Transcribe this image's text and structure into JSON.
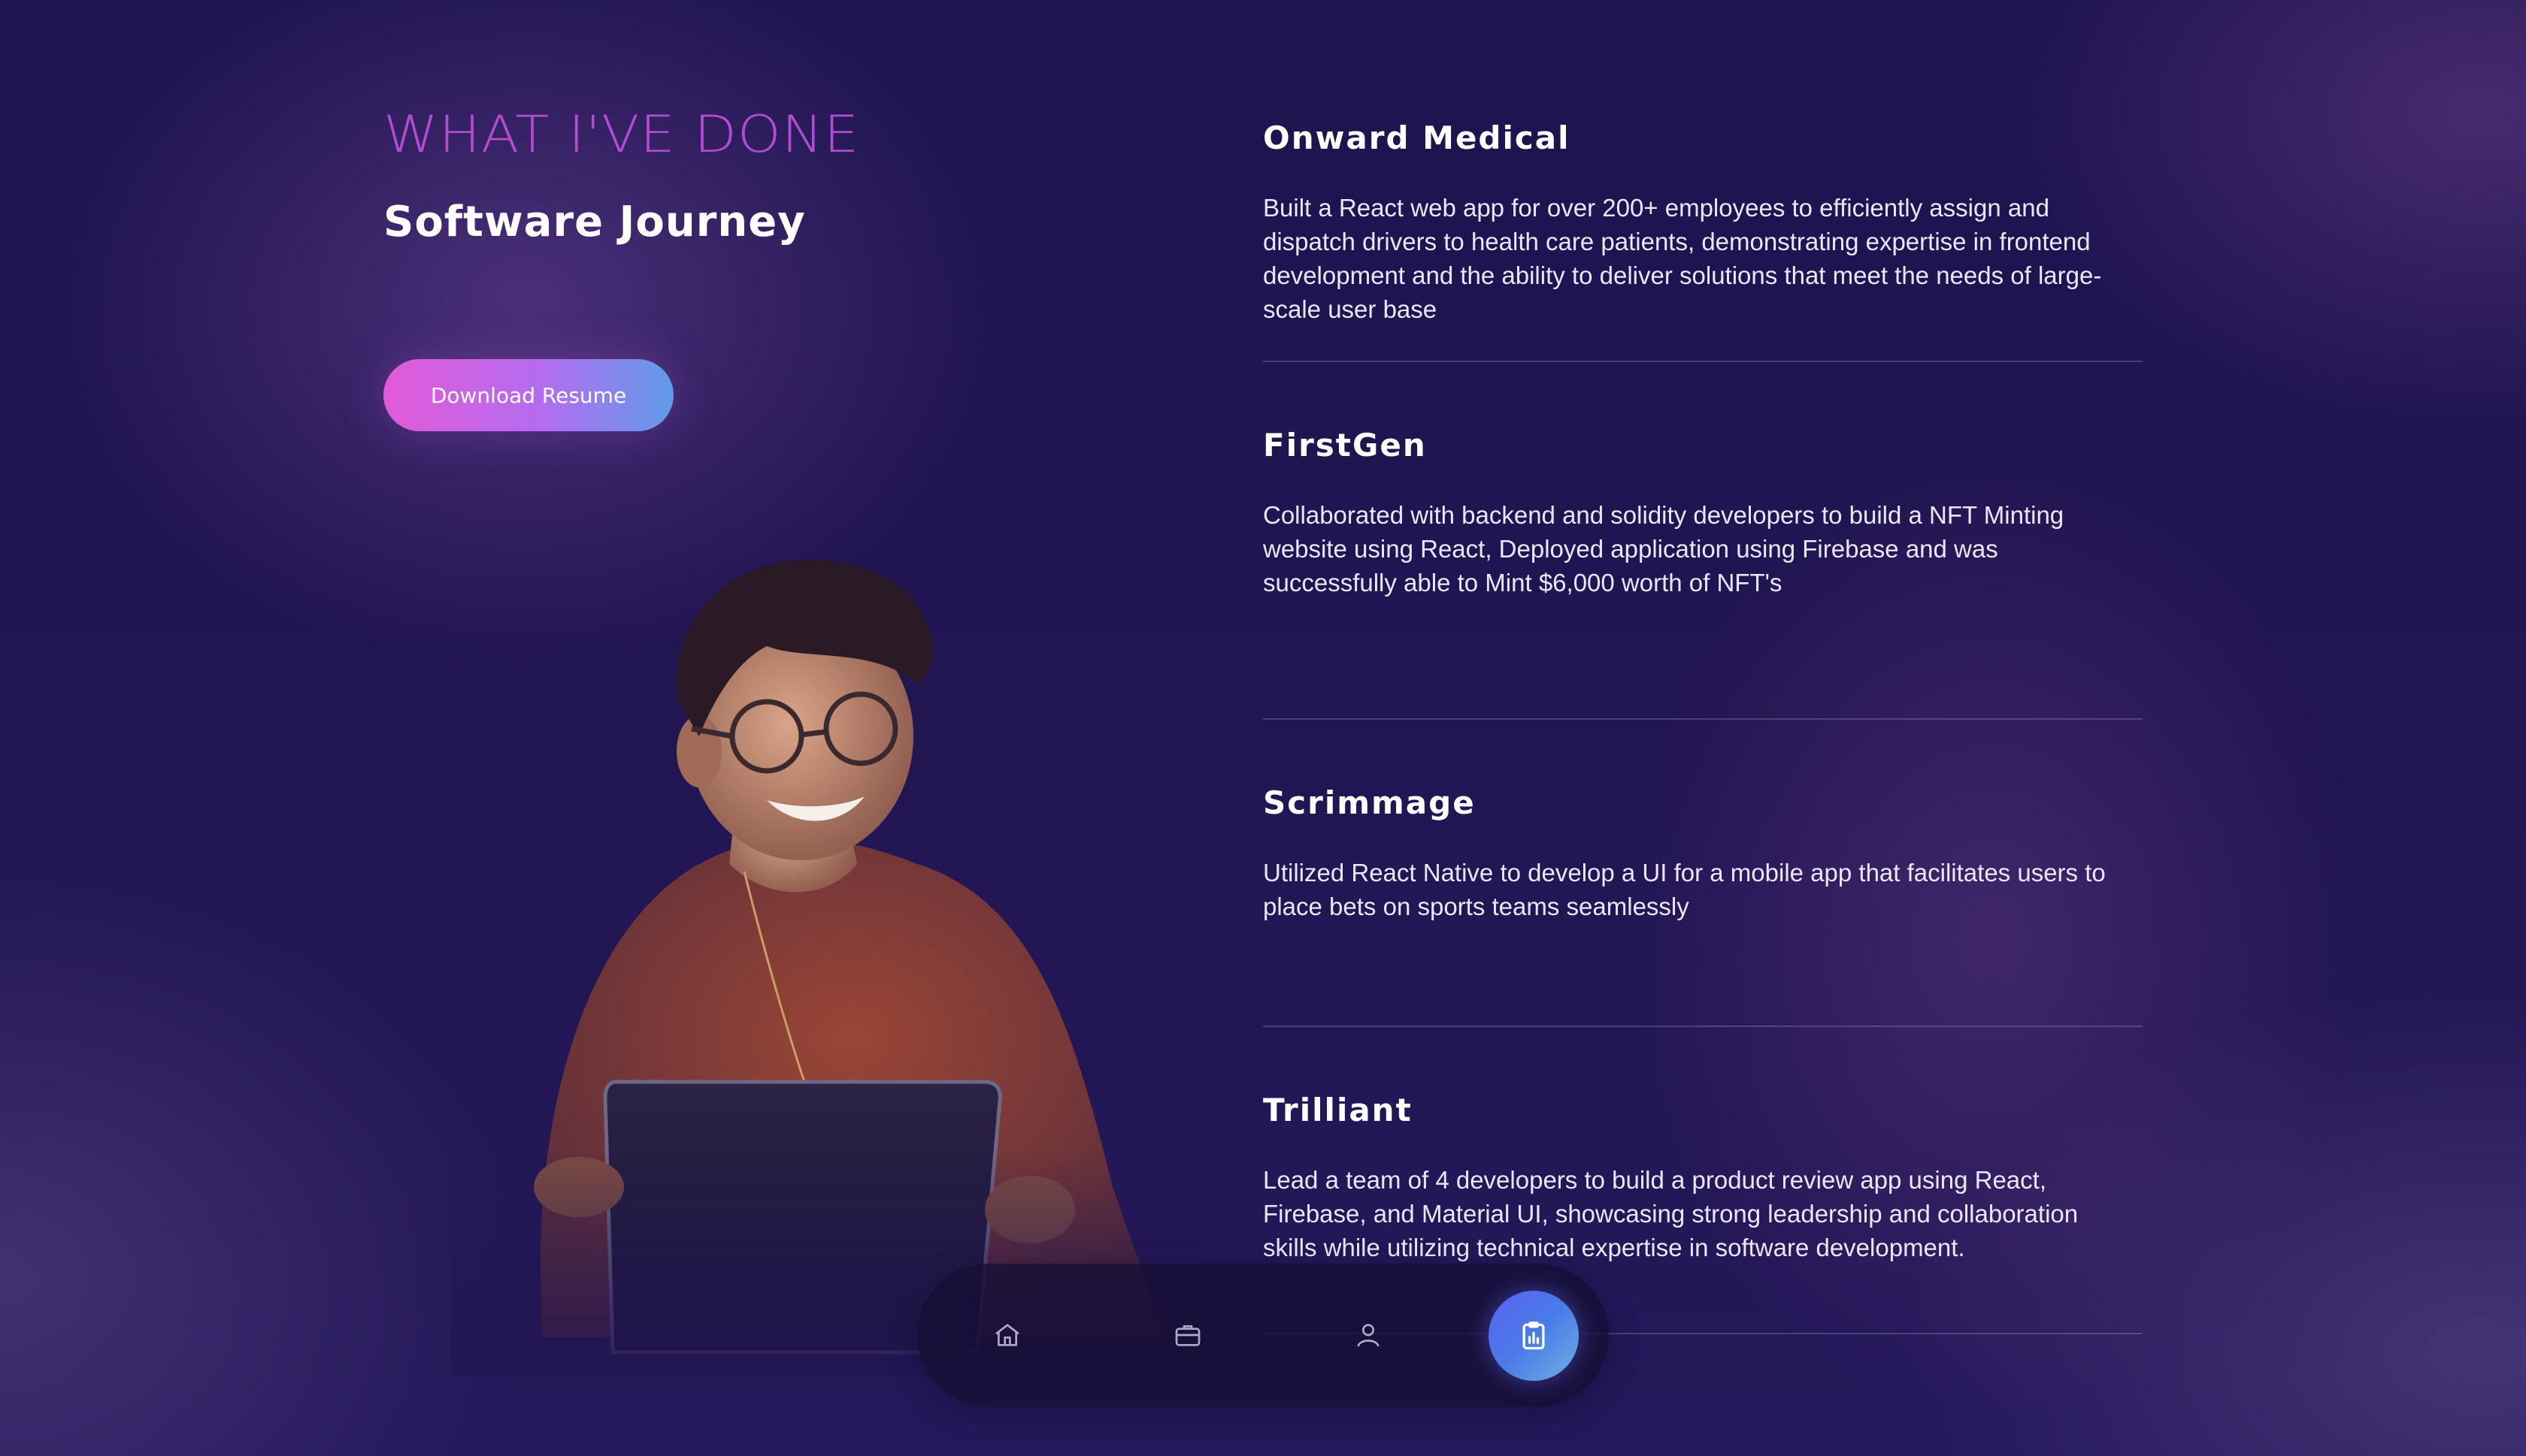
{
  "header": {
    "eyebrow": "WHAT I'VE DONE",
    "subtitle": "Software Journey",
    "resume_button": "Download Resume"
  },
  "experience": [
    {
      "company": "Onward Medical",
      "description": "Built a React web app for over 200+ employees to efficiently assign and dispatch drivers to health care patients, demonstrating expertise in frontend development and the ability to deliver solutions that meet the needs of large-scale user base"
    },
    {
      "company": "FirstGen",
      "description": "Collaborated with backend and solidity developers to build a NFT Minting website using React, Deployed application using Firebase and was successfully able to Mint $6,000 worth of NFT's"
    },
    {
      "company": "Scrimmage",
      "description": "Utilized React Native to develop a UI for a mobile app that facilitates users to place bets on sports teams seamlessly"
    },
    {
      "company": "Trilliant",
      "description": "Lead a team of 4 developers to build a product review app using React, Firebase, and Material UI, showcasing strong leadership and collaboration skills while utilizing technical expertise in software development."
    }
  ],
  "dock": {
    "items": [
      {
        "icon": "home-icon"
      },
      {
        "icon": "briefcase-icon"
      },
      {
        "icon": "user-icon"
      },
      {
        "icon": "clipboard-chart-icon",
        "active": true
      }
    ]
  },
  "colors": {
    "accent": "#b44bd3",
    "button_gradient_start": "#e25ad8",
    "button_gradient_end": "#5f9ce8",
    "active_dock": "#5a61f0"
  }
}
